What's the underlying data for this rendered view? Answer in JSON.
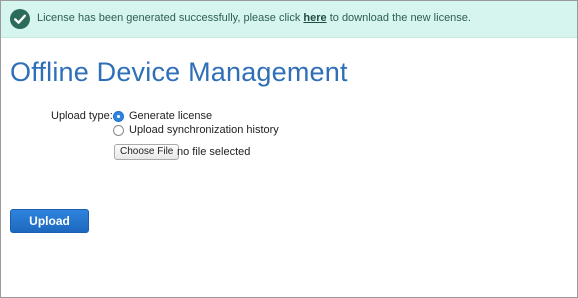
{
  "banner": {
    "text_before": "License has been generated successfully, please click ",
    "link": "here",
    "text_after": " to download the new license."
  },
  "page": {
    "title": "Offline Device Management"
  },
  "form": {
    "upload_type_label": "Upload type:",
    "options": [
      {
        "label": "Generate license",
        "selected": true
      },
      {
        "label": "Upload synchronization history",
        "selected": false
      }
    ],
    "file": {
      "button_label": "Choose File",
      "status": "no file selected"
    }
  },
  "actions": {
    "upload_label": "Upload"
  },
  "colors": {
    "banner_bg": "#d6f5ee",
    "title": "#2f6fb8",
    "primary": "#2f84dd",
    "success_icon": "#2a6b5a"
  }
}
